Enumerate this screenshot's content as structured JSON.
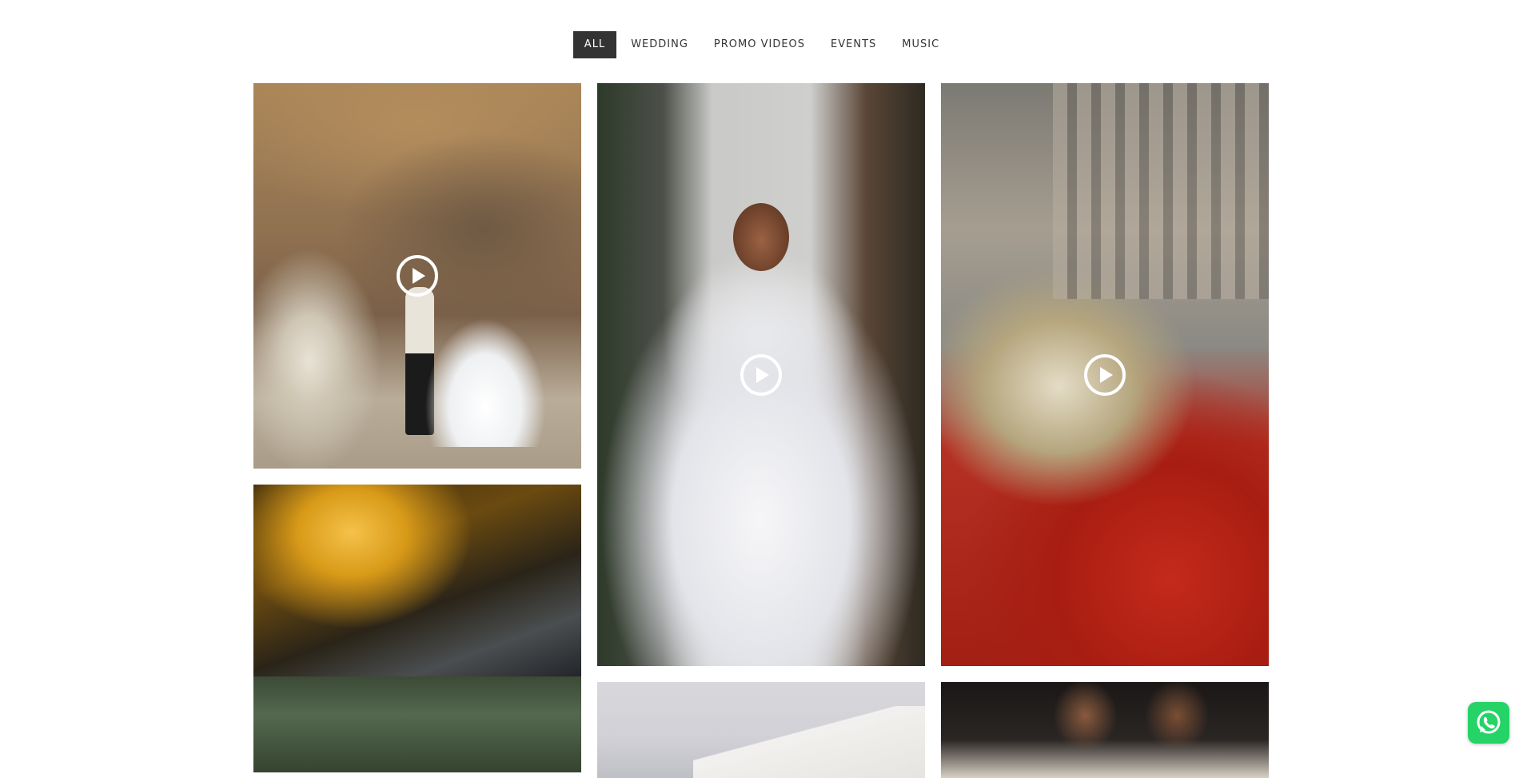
{
  "filters": {
    "items": [
      {
        "label": "ALL",
        "active": true
      },
      {
        "label": "WEDDING",
        "active": false
      },
      {
        "label": "PROMO VIDEOS",
        "active": false
      },
      {
        "label": "EVENTS",
        "active": false
      },
      {
        "label": "MUSIC",
        "active": false
      }
    ]
  },
  "gallery": {
    "tiles": [
      {
        "subject": "couple in cave",
        "has_play": true
      },
      {
        "subject": "bride in white dress",
        "has_play": true
      },
      {
        "subject": "flowers on red car",
        "has_play": true
      },
      {
        "subject": "golden ring reflection",
        "has_play": false
      },
      {
        "subject": "forest scene",
        "has_play": false
      },
      {
        "subject": "white building",
        "has_play": false
      },
      {
        "subject": "singers performing",
        "has_play": false
      }
    ],
    "play_icon": "play-circle-icon"
  },
  "floating": {
    "whatsapp_icon": "whatsapp-icon",
    "whatsapp_color": "#25d366"
  },
  "colors": {
    "active_filter_bg": "#333333",
    "active_filter_text": "#ffffff",
    "filter_text": "#333333"
  }
}
